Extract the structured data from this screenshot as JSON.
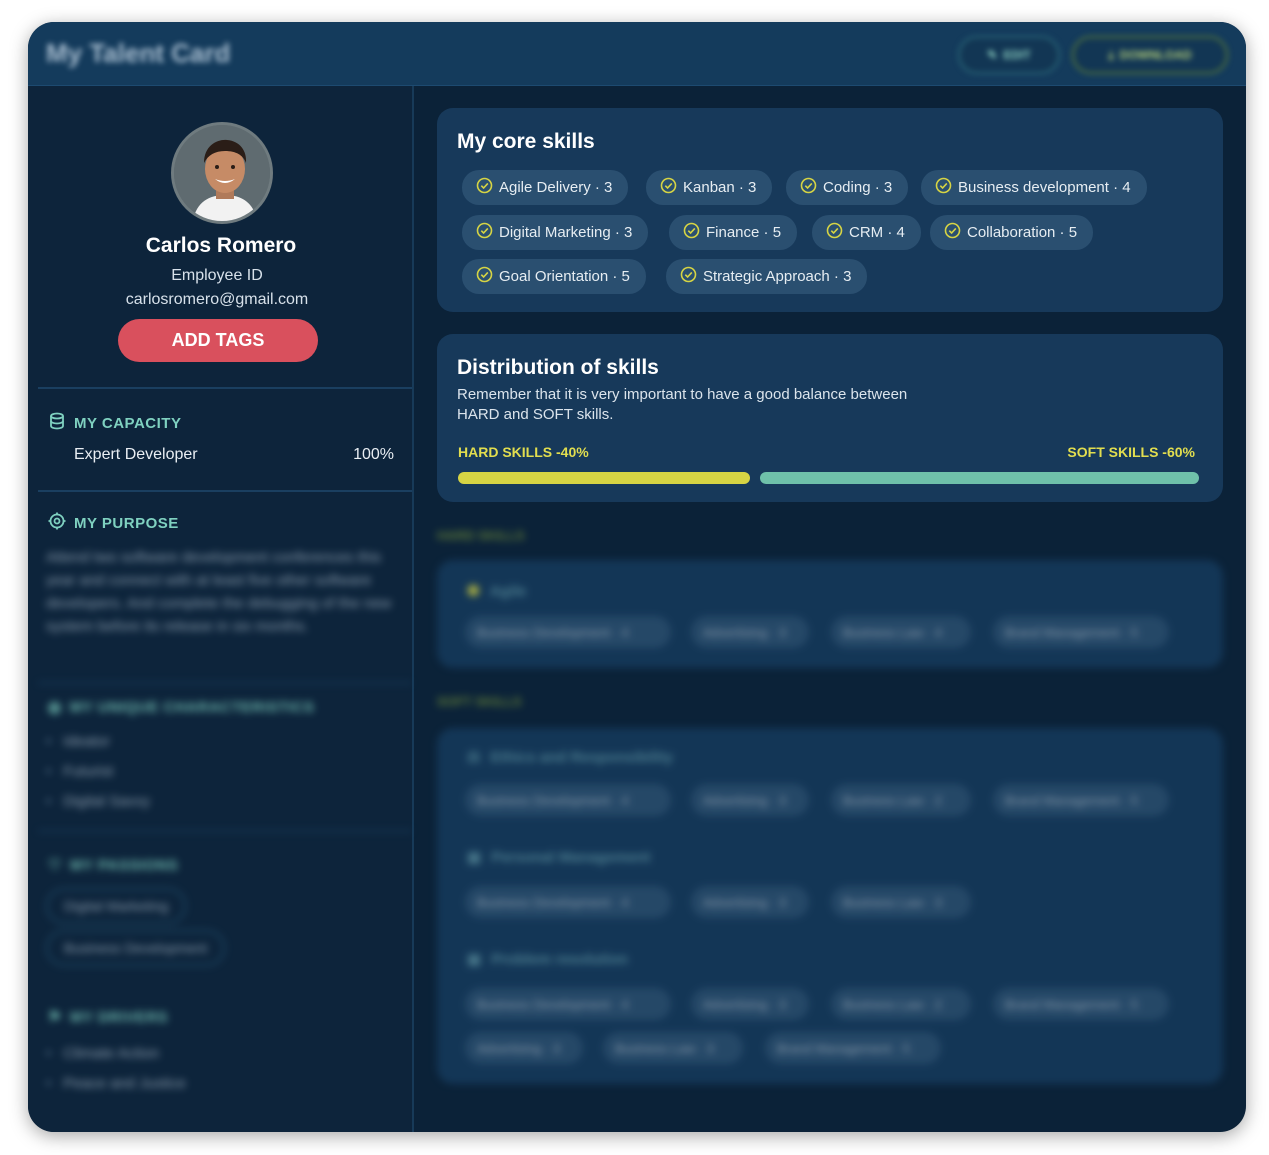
{
  "app": {
    "title": "My Talent Card",
    "edit_label": "EDIT",
    "download_label": "DOWNLOAD"
  },
  "profile": {
    "name": "Carlos Romero",
    "employee_id": "Employee ID",
    "email": "carlosromero@gmail.com",
    "add_tags_label": "ADD TAGS"
  },
  "capacity": {
    "heading": "MY CAPACITY",
    "role": "Expert Developer",
    "percent": "100%"
  },
  "purpose": {
    "heading": "MY PURPOSE",
    "text": "Attend two software development conferences this year and connect with at least five other software developers. And complete the debugging of the new system before its release in six months."
  },
  "unique": {
    "heading": "MY UNIQUE CHARACTERISTICS",
    "items": [
      "Ideator",
      "Futurist",
      "Digital Savvy"
    ]
  },
  "passions": {
    "heading": "MY PASSIONS",
    "items": [
      "Digital Marketing",
      "Business Development"
    ]
  },
  "drivers": {
    "heading": "MY DRIVERS",
    "items": [
      "Climate Action",
      "Peace and Justice"
    ]
  },
  "core_skills": {
    "title": "My core skills",
    "chips": [
      "Agile Delivery · 3",
      "Kanban · 3",
      "Coding · 3",
      "Business development · 4",
      "Digital Marketing · 3",
      "Finance · 5",
      "CRM · 4",
      "Collaboration · 5",
      "Goal Orientation · 5",
      "Strategic Approach · 3"
    ]
  },
  "distribution": {
    "title": "Distribution of skills",
    "description": "Remember that it is very important to have a good balance between HARD and SOFT skills.",
    "hard_label": "HARD SKILLS -40%",
    "soft_label": "SOFT SKILLS -60%",
    "hard_fraction": 0.4,
    "soft_fraction": 0.6
  },
  "hard_skills": {
    "heading": "HARD SKILLS",
    "groups": [
      {
        "name": "Agile",
        "chips": [
          "Business Development · 4",
          "Advertising · 3",
          "Business Law · 4",
          "Brand Management · 5"
        ]
      }
    ]
  },
  "soft_skills": {
    "heading": "SOFT SKILLS",
    "groups": [
      {
        "name": "Ethics and Responsibility",
        "chips": [
          "Business Development · 4",
          "Advertising · 3",
          "Business Law · 2",
          "Brand Management · 5"
        ]
      },
      {
        "name": "Personal Management",
        "chips": [
          "Business Development · 4",
          "Advertising · 3",
          "Business Law · 3"
        ]
      },
      {
        "name": "Problem resolution",
        "chips": [
          "Business Development · 4",
          "Advertising · 3",
          "Business Law · 2",
          "Brand Management · 5",
          "Advertising · 3",
          "Business Law · 3",
          "Brand Management · 5"
        ]
      }
    ]
  },
  "colors": {
    "accent_yellow": "#d6d444",
    "accent_teal": "#6fc1aa",
    "add_tags": "#d9505d",
    "card": "#17395a"
  },
  "icons": {
    "capacity": "database-icon",
    "purpose": "target-icon",
    "chip": "check-circle-icon"
  }
}
